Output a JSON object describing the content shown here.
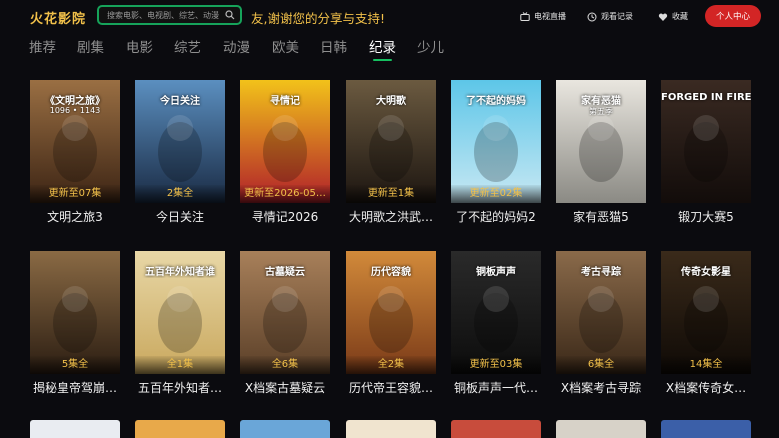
{
  "header": {
    "logo": "火花影院",
    "search_placeholder": "搜索电影、电视剧、综艺、动漫",
    "slogan": "友,谢谢您的分享与支持!",
    "tools": [
      {
        "label": "电视直播",
        "icon": "tv-icon"
      },
      {
        "label": "观看记录",
        "icon": "clock-icon"
      },
      {
        "label": "收藏",
        "icon": "heart-icon"
      }
    ],
    "user_center": "个人中心",
    "accent": "#f2c14a",
    "button_color": "#d32525",
    "search_border": "#16a35a"
  },
  "tabs": [
    {
      "label": "推荐",
      "active": false
    },
    {
      "label": "剧集",
      "active": false
    },
    {
      "label": "电影",
      "active": false
    },
    {
      "label": "综艺",
      "active": false
    },
    {
      "label": "动漫",
      "active": false
    },
    {
      "label": "欧美",
      "active": false
    },
    {
      "label": "日韩",
      "active": false
    },
    {
      "label": "纪录",
      "active": true
    },
    {
      "label": "少儿",
      "active": false
    }
  ],
  "rows": [
    [
      {
        "title": "文明之旅3",
        "badge": "更新至07集",
        "poster_text": "《文明之旅》",
        "poster_sub": "1096 • 1143",
        "colors": [
          "#9a6f43",
          "#3c2414"
        ]
      },
      {
        "title": "今日关注",
        "badge": "2集全",
        "poster_text": "今日关注",
        "poster_sub": "",
        "colors": [
          "#5b8fc0",
          "#1a2b44"
        ]
      },
      {
        "title": "寻情记2026",
        "badge": "更新至2026-05…",
        "poster_text": "寻情记",
        "poster_sub": "",
        "colors": [
          "#f2c21a",
          "#b01f2a"
        ]
      },
      {
        "title": "大明歌之洪武…",
        "badge": "更新至1集",
        "poster_text": "大明歌",
        "poster_sub": "",
        "colors": [
          "#6b5a40",
          "#1c1510"
        ]
      },
      {
        "title": "了不起的妈妈2",
        "badge": "更新至02集",
        "poster_text": "了不起的妈妈",
        "poster_sub": "",
        "colors": [
          "#5dc6e8",
          "#c8e8f3"
        ]
      },
      {
        "title": "家有恶猫5",
        "badge": "",
        "poster_text": "家有恶猫",
        "poster_sub": "第五季",
        "colors": [
          "#e9e6df",
          "#8b8a84"
        ]
      },
      {
        "title": "锻刀大赛5",
        "badge": "",
        "poster_text": "FORGED IN FIRE",
        "poster_sub": "",
        "colors": [
          "#3a2a22",
          "#120c0a"
        ]
      }
    ],
    [
      {
        "title": "揭秘皇帝驾崩…",
        "badge": "5集全",
        "poster_text": "",
        "poster_sub": "",
        "colors": [
          "#8a6a44",
          "#2b1d12"
        ]
      },
      {
        "title": "五百年外知者…",
        "badge": "全1集",
        "poster_text": "五百年外知者谁",
        "poster_sub": "",
        "colors": [
          "#e8d7a6",
          "#c9a85e"
        ]
      },
      {
        "title": "X档案古墓疑云",
        "badge": "全6集",
        "poster_text": "古墓疑云",
        "poster_sub": "",
        "colors": [
          "#a8805a",
          "#5a3f28"
        ]
      },
      {
        "title": "历代帝王容貌…",
        "badge": "全2集",
        "poster_text": "历代容貌",
        "poster_sub": "",
        "colors": [
          "#d28a3a",
          "#7a3a18"
        ]
      },
      {
        "title": "铜板声声一代…",
        "badge": "更新至03集",
        "poster_text": "铜板声声",
        "poster_sub": "",
        "colors": [
          "#2a2a2a",
          "#0c0c0c"
        ]
      },
      {
        "title": "X档案考古寻踪",
        "badge": "6集全",
        "poster_text": "考古寻踪",
        "poster_sub": "",
        "colors": [
          "#8a6a4a",
          "#3a2818"
        ]
      },
      {
        "title": "X档案传奇女…",
        "badge": "14集全",
        "poster_text": "传奇女影星",
        "poster_sub": "",
        "colors": [
          "#3a2a1a",
          "#0f0a06"
        ]
      }
    ]
  ],
  "next_row_colors": [
    "#e9ecf1",
    "#e8a94a",
    "#6aa6d8",
    "#f0e4cf",
    "#c84c3c",
    "#d7d2c8",
    "#3b5fa8"
  ]
}
